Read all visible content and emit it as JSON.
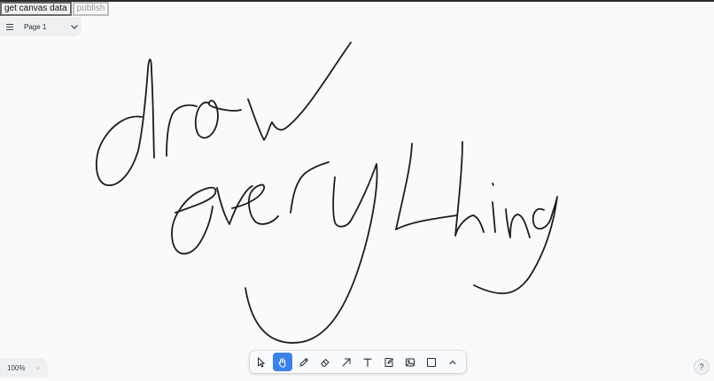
{
  "debug_buttons": {
    "get_canvas_data_label": "get canvas data",
    "publish_label": "publish"
  },
  "page_menu": {
    "menu_icon": "hamburger-menu-icon",
    "page_name": "Page 1",
    "dropdown_icon": "chevron-down-icon"
  },
  "canvas": {
    "drawing_text": "draw everything",
    "stroke_color": "#1d1d1d",
    "background": "#f9fafb"
  },
  "zoom": {
    "value": "100%",
    "more_label": "»"
  },
  "toolbar": {
    "active_color": "#3b82e8",
    "tools": [
      {
        "name": "Select",
        "icon": "cursor-icon",
        "active": false
      },
      {
        "name": "Hand",
        "icon": "hand-icon",
        "active": true
      },
      {
        "name": "Draw",
        "icon": "pencil-icon",
        "active": false
      },
      {
        "name": "Eraser",
        "icon": "eraser-icon",
        "active": false
      },
      {
        "name": "Arrow",
        "icon": "arrow-icon",
        "active": false
      },
      {
        "name": "Text",
        "icon": "text-icon",
        "active": false
      },
      {
        "name": "Note",
        "icon": "note-icon",
        "active": false
      },
      {
        "name": "Asset",
        "icon": "image-icon",
        "active": false
      },
      {
        "name": "Rectangle",
        "icon": "rectangle-icon",
        "active": false
      },
      {
        "name": "More",
        "icon": "chevron-up-icon",
        "active": false
      }
    ]
  },
  "help": {
    "label": "?"
  }
}
